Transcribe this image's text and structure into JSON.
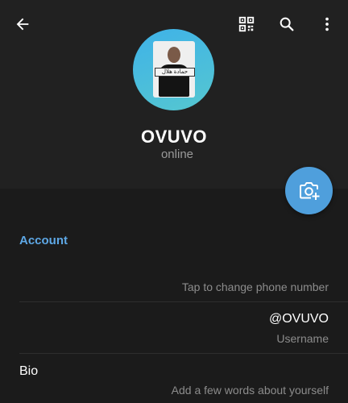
{
  "profile": {
    "name": "OVUVO",
    "status": "online",
    "avatar_caption": "حمادة هلال"
  },
  "toolbar": {
    "back_icon": "arrow-left-icon",
    "qr_icon": "qr-code-icon",
    "search_icon": "search-icon",
    "more_icon": "more-vertical-icon"
  },
  "fab": {
    "icon": "camera-add-icon",
    "color": "#4f9fdc"
  },
  "account": {
    "section_title": "Account",
    "phone_hint": "Tap to change phone number",
    "username_value": "@OVUVO",
    "username_hint": "Username",
    "bio_label": "Bio",
    "bio_hint": "Add a few words about yourself"
  },
  "colors": {
    "background": "#1b1b1b",
    "header": "#212121",
    "accent": "#5ea8e6",
    "hint": "#8c8c8c"
  }
}
